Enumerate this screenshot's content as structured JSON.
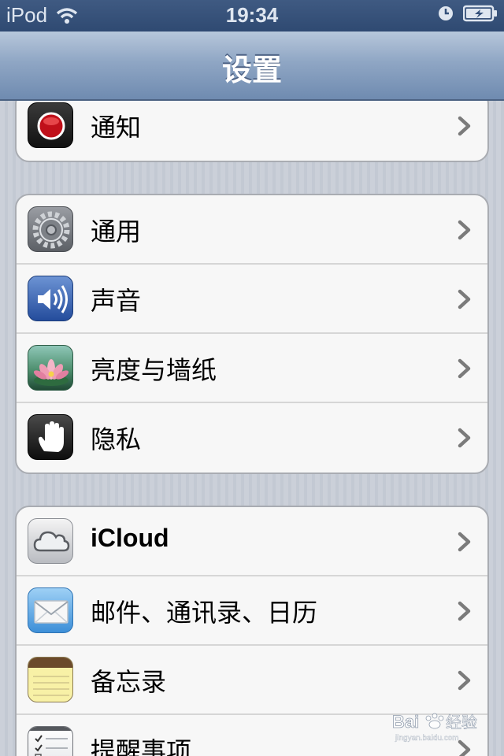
{
  "status_bar": {
    "device": "iPod",
    "time": "19:34"
  },
  "nav": {
    "title": "设置"
  },
  "groups": [
    {
      "items": [
        {
          "label": "通知",
          "icon": "notifications-icon"
        }
      ]
    },
    {
      "items": [
        {
          "label": "通用",
          "icon": "gear-icon"
        },
        {
          "label": "声音",
          "icon": "speaker-icon"
        },
        {
          "label": "亮度与墙纸",
          "icon": "flower-wallpaper-icon"
        },
        {
          "label": "隐私",
          "icon": "hand-icon"
        }
      ]
    },
    {
      "items": [
        {
          "label": "iCloud",
          "icon": "cloud-icon"
        },
        {
          "label": "邮件、通讯录、日历",
          "icon": "mail-envelope-icon"
        },
        {
          "label": "备忘录",
          "icon": "notes-pad-icon"
        },
        {
          "label": "提醒事项",
          "icon": "reminders-checklist-icon"
        }
      ]
    }
  ],
  "watermark": {
    "brand": "Baidu经验",
    "url": "jingyan.baidu.com"
  },
  "colors": {
    "nav_bar": "#7f98bb",
    "status_bar": "#34507a",
    "background": "#c9cdd6"
  }
}
